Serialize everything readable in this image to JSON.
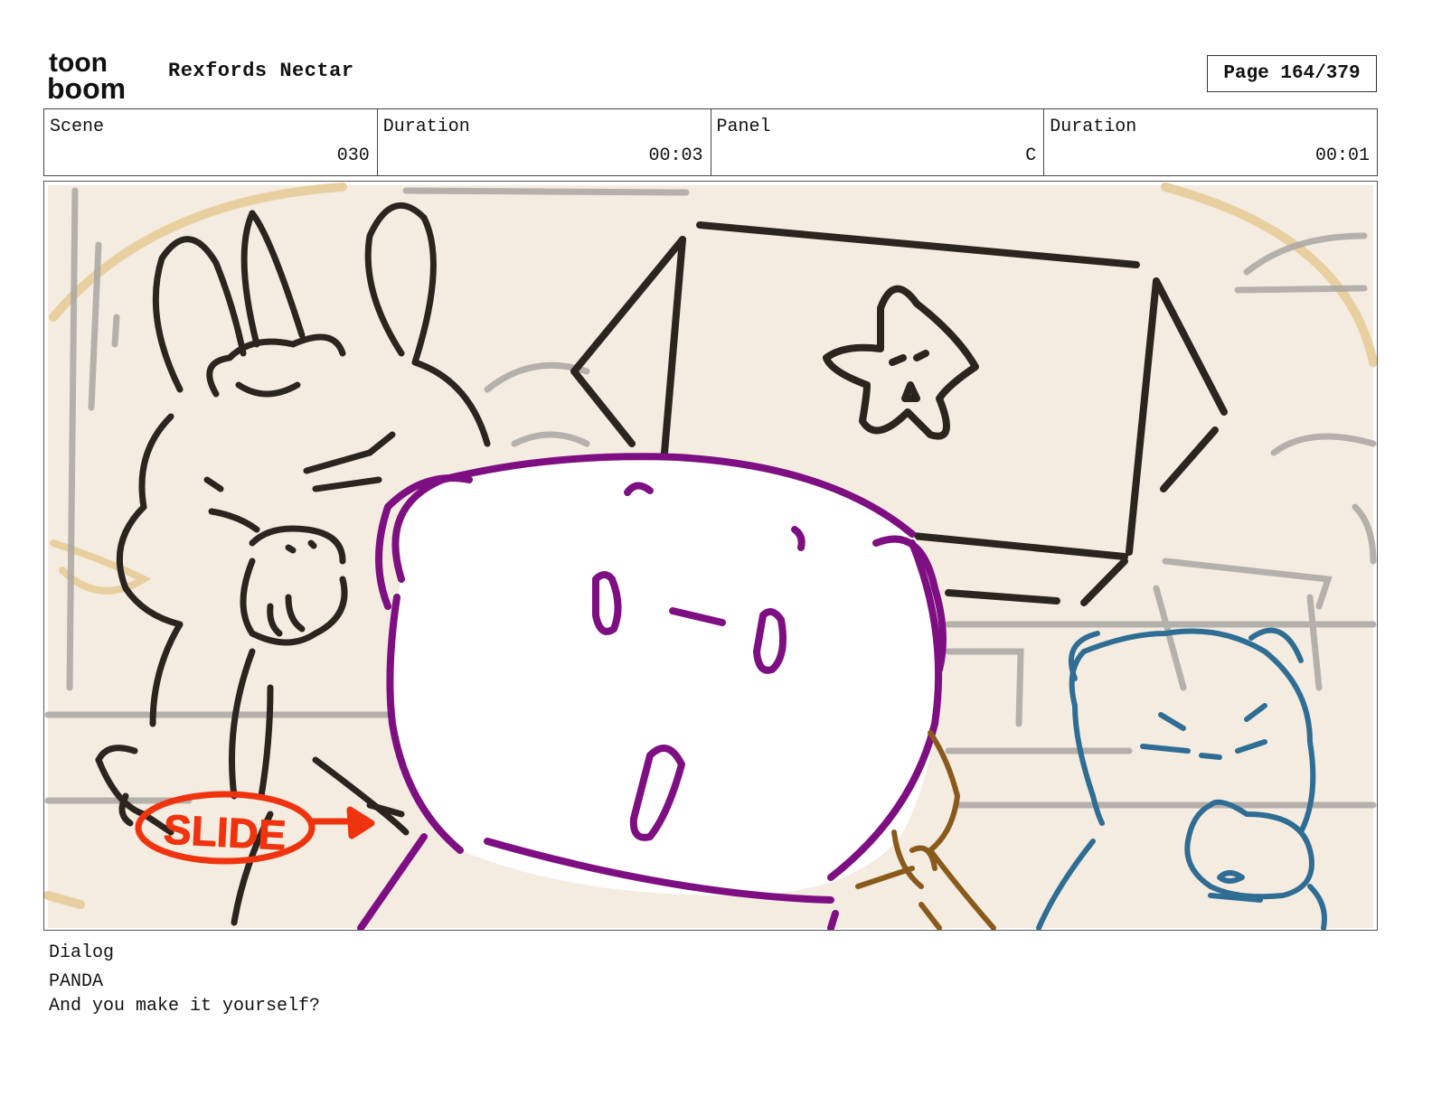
{
  "header": {
    "logo_text_top": "toon",
    "logo_text_bottom": "boom",
    "project_title": "Rexfords Nectar",
    "page_label": "Page 164/379"
  },
  "info": {
    "scene_label": "Scene",
    "scene_value": "030",
    "scene_duration_label": "Duration",
    "scene_duration_value": "00:03",
    "panel_label": "Panel",
    "panel_value": "C",
    "panel_duration_label": "Duration",
    "panel_duration_value": "00:01"
  },
  "panel": {
    "annotation_text": "SLIDE",
    "colors": {
      "background": "#f4ece0",
      "line_dark": "#2b2520",
      "panda": "#7e0f82",
      "blue_bear": "#2f6d94",
      "brown_bear": "#8a5a1c",
      "annotation": "#f0330f",
      "sketch_gray": "#a9a6a2",
      "sketch_tan": "#e8cfa0"
    }
  },
  "dialog": {
    "label": "Dialog",
    "speaker": "PANDA",
    "line": "And you make it yourself?"
  }
}
